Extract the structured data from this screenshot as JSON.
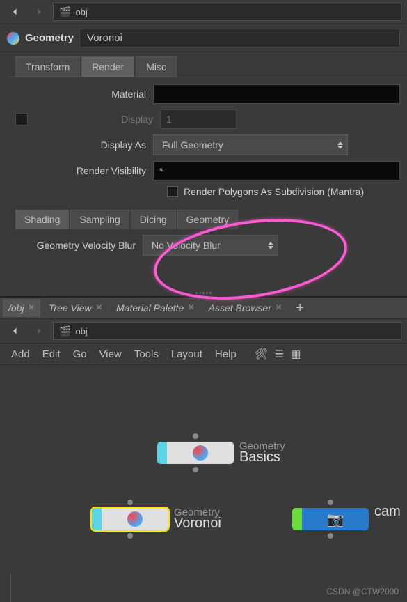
{
  "top_toolbar": {
    "path": "obj"
  },
  "header": {
    "type_label": "Geometry",
    "name": "Voronoi"
  },
  "main_tabs": {
    "transform": "Transform",
    "render": "Render",
    "misc": "Misc"
  },
  "render_props": {
    "material_label": "Material",
    "material_value": "",
    "display_label": "Display",
    "display_value": "1",
    "display_as_label": "Display As",
    "display_as_value": "Full Geometry",
    "render_vis_label": "Render Visibility",
    "render_vis_value": "*",
    "subdiv_label": "Render Polygons As Subdivision (Mantra)"
  },
  "sub_tabs": {
    "shading": "Shading",
    "sampling": "Sampling",
    "dicing": "Dicing",
    "geometry": "Geometry"
  },
  "velocity": {
    "label": "Geometry Velocity Blur",
    "value": "No Velocity Blur"
  },
  "lower_tabs": {
    "path": "/obj",
    "tree_view": "Tree View",
    "material_palette": "Material Palette",
    "asset_browser": "Asset Browser"
  },
  "lower_toolbar": {
    "path": "obj"
  },
  "menu": {
    "add": "Add",
    "edit": "Edit",
    "go": "Go",
    "view": "View",
    "tools": "Tools",
    "layout": "Layout",
    "help": "Help"
  },
  "nodes": {
    "basics": {
      "type": "Geometry",
      "name": "Basics"
    },
    "voronoi": {
      "type": "Geometry",
      "name": "Voronoi"
    },
    "cam": {
      "type": "",
      "name": "cam"
    }
  },
  "watermark": "CSDN @CTW2000"
}
